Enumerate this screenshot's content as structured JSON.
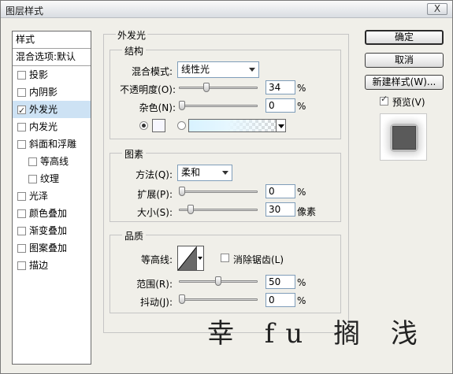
{
  "window": {
    "title": "图层样式",
    "close_label": "X"
  },
  "sidebar": {
    "header": "样式",
    "blend_options": "混合选项:默认",
    "items": [
      {
        "label": "投影",
        "checked": false,
        "selected": false,
        "sub": false
      },
      {
        "label": "内阴影",
        "checked": false,
        "selected": false,
        "sub": false
      },
      {
        "label": "外发光",
        "checked": true,
        "selected": true,
        "sub": false
      },
      {
        "label": "内发光",
        "checked": false,
        "selected": false,
        "sub": false
      },
      {
        "label": "斜面和浮雕",
        "checked": false,
        "selected": false,
        "sub": false
      },
      {
        "label": "等高线",
        "checked": false,
        "selected": false,
        "sub": true
      },
      {
        "label": "纹理",
        "checked": false,
        "selected": false,
        "sub": true
      },
      {
        "label": "光泽",
        "checked": false,
        "selected": false,
        "sub": false
      },
      {
        "label": "颜色叠加",
        "checked": false,
        "selected": false,
        "sub": false
      },
      {
        "label": "渐变叠加",
        "checked": false,
        "selected": false,
        "sub": false
      },
      {
        "label": "图案叠加",
        "checked": false,
        "selected": false,
        "sub": false
      },
      {
        "label": "描边",
        "checked": false,
        "selected": false,
        "sub": false
      }
    ]
  },
  "panel": {
    "title": "外发光",
    "structure": {
      "legend": "结构",
      "blend_mode_label": "混合模式:",
      "blend_mode_value": "线性光",
      "opacity_label": "不透明度(O):",
      "opacity_value": "34",
      "opacity_fraction": 0.34,
      "noise_label": "杂色(N):",
      "noise_value": "0",
      "noise_fraction": 0,
      "percent": "%"
    },
    "elements": {
      "legend": "图素",
      "technique_label": "方法(Q):",
      "technique_value": "柔和",
      "spread_label": "扩展(P):",
      "spread_value": "0",
      "spread_fraction": 0,
      "size_label": "大小(S):",
      "size_value": "30",
      "size_fraction": 0.12,
      "size_unit": "像素",
      "percent": "%"
    },
    "quality": {
      "legend": "品质",
      "contour_label": "等高线:",
      "antialias_label": "消除锯齿(L)",
      "range_label": "范围(R):",
      "range_value": "50",
      "range_fraction": 0.5,
      "jitter_label": "抖动(J):",
      "jitter_value": "0",
      "jitter_fraction": 0,
      "percent": "%"
    }
  },
  "buttons": {
    "ok": "确定",
    "cancel": "取消",
    "new_style": "新建样式(W)...",
    "preview_label": "预览(V)",
    "preview_checked": true
  },
  "watermark": "幸 fu 搁 浅",
  "colors": {
    "selection": "#cde2f4",
    "glow_gradient_start": "#d8f2ff"
  }
}
